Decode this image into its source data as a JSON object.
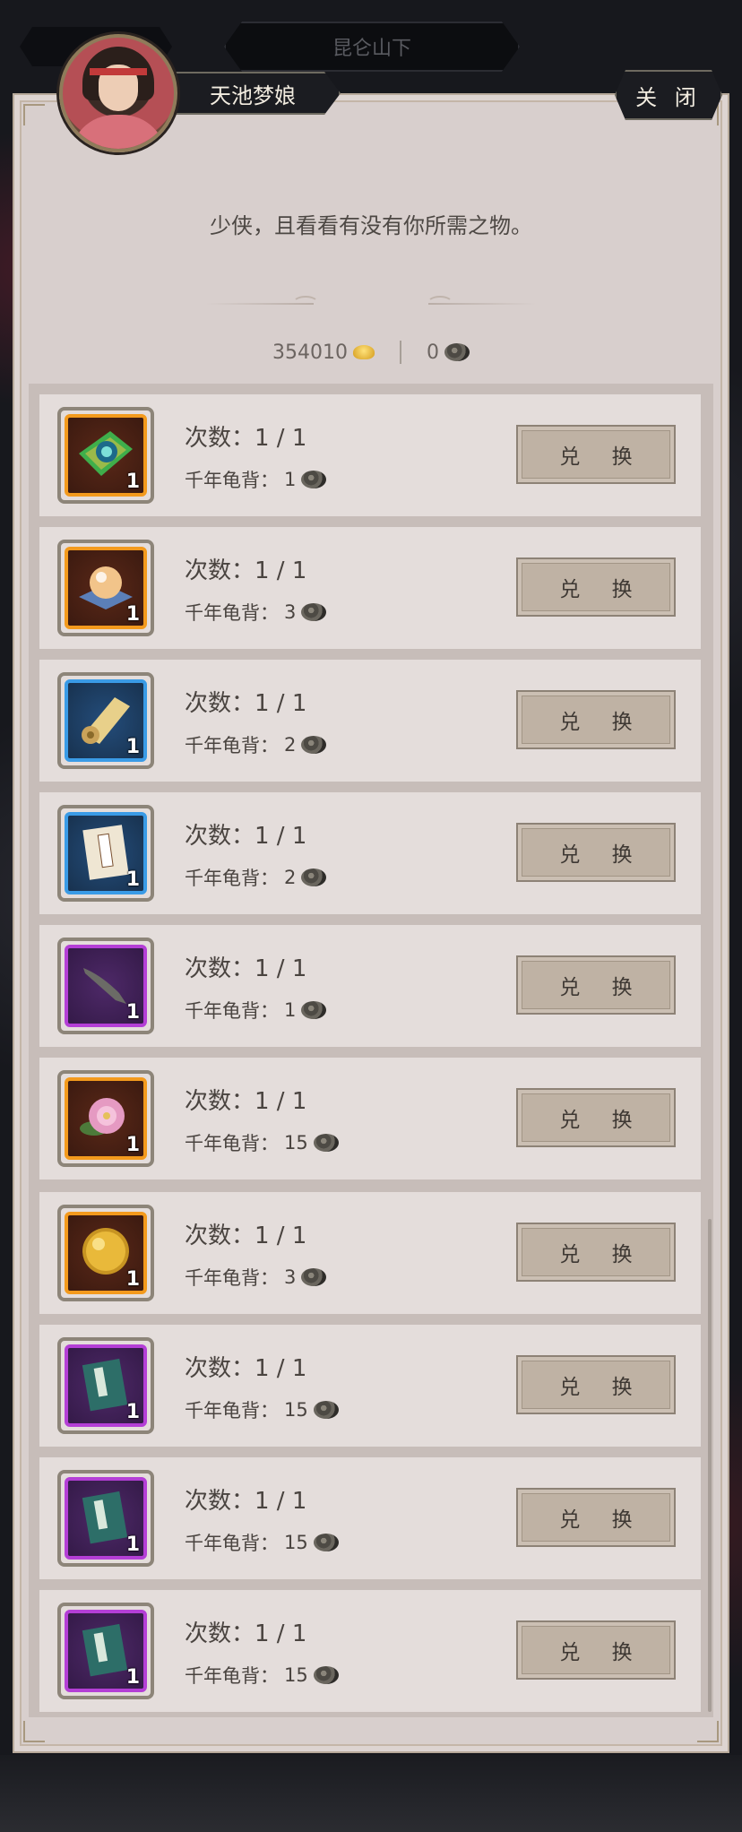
{
  "location": "昆仑山下",
  "npc": {
    "name": "天池梦娘",
    "dialog": "少侠，且看看有没有你所需之物。"
  },
  "close_label": "关 闭",
  "currency": {
    "gold": "354010",
    "shell": "0"
  },
  "items": [
    {
      "quality": "orange",
      "icon": "jade-cloth-icon",
      "qty": "1",
      "count_label": "次数：1 / 1",
      "cost_label": "千年龟背：",
      "cost": "1",
      "button": "兑 换"
    },
    {
      "quality": "orange",
      "icon": "pearl-orb-icon",
      "qty": "1",
      "count_label": "次数：1 / 1",
      "cost_label": "千年龟背：",
      "cost": "3",
      "button": "兑 换"
    },
    {
      "quality": "blue",
      "icon": "scroll-icon",
      "qty": "1",
      "count_label": "次数：1 / 1",
      "cost_label": "千年龟背：",
      "cost": "2",
      "button": "兑 换"
    },
    {
      "quality": "blue",
      "icon": "manual-book-icon",
      "qty": "1",
      "count_label": "次数：1 / 1",
      "cost_label": "千年龟背：",
      "cost": "2",
      "button": "兑 换"
    },
    {
      "quality": "purple",
      "icon": "fish-icon",
      "qty": "1",
      "count_label": "次数：1 / 1",
      "cost_label": "千年龟背：",
      "cost": "1",
      "button": "兑 换"
    },
    {
      "quality": "orange",
      "icon": "pink-flower-icon",
      "qty": "1",
      "count_label": "次数：1 / 1",
      "cost_label": "千年龟背：",
      "cost": "15",
      "button": "兑 换"
    },
    {
      "quality": "orange",
      "icon": "golden-orb-icon",
      "qty": "1",
      "count_label": "次数：1 / 1",
      "cost_label": "千年龟背：",
      "cost": "3",
      "button": "兑 换"
    },
    {
      "quality": "purple",
      "icon": "green-book-icon",
      "qty": "1",
      "count_label": "次数：1 / 1",
      "cost_label": "千年龟背：",
      "cost": "15",
      "button": "兑 换"
    },
    {
      "quality": "purple",
      "icon": "green-book-icon",
      "qty": "1",
      "count_label": "次数：1 / 1",
      "cost_label": "千年龟背：",
      "cost": "15",
      "button": "兑 换"
    },
    {
      "quality": "purple",
      "icon": "green-book-icon",
      "qty": "1",
      "count_label": "次数：1 / 1",
      "cost_label": "千年龟背：",
      "cost": "15",
      "button": "兑 换"
    }
  ],
  "colors": {
    "orange": "#f39a1d",
    "blue": "#3a9be6",
    "purple": "#b43fd6",
    "panel": "#d8cfcd"
  }
}
